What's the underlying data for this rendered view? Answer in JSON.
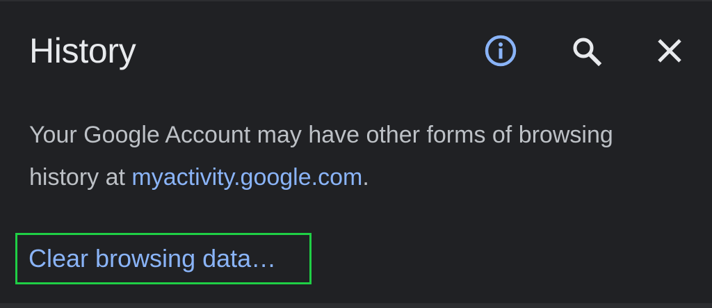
{
  "header": {
    "title": "History",
    "icons": {
      "info": "info-icon",
      "search": "search-icon",
      "close": "close-icon"
    }
  },
  "notice": {
    "text_before": "Your Google Account may have other forms of browsing history at ",
    "link_text": "myactivity.google.com",
    "text_after": "."
  },
  "actions": {
    "clear_label": "Clear browsing data…"
  },
  "colors": {
    "background": "#202124",
    "title": "#e8eaed",
    "body_text": "#bdc1c6",
    "accent": "#8ab4f8",
    "highlight_border": "#1fcf45"
  }
}
